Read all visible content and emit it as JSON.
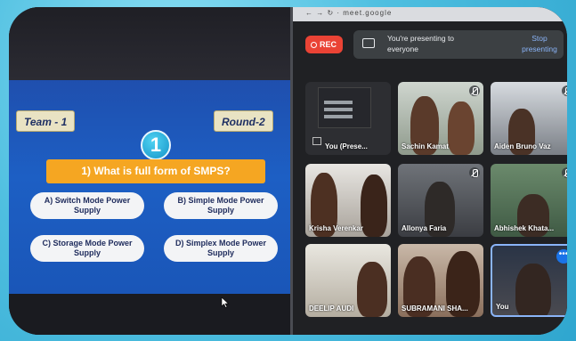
{
  "slide": {
    "team": "Team - 1",
    "round": "Round-2",
    "question_number": "1",
    "question": "1) What is full form of SMPS?",
    "options": [
      {
        "line1": "A) Switch Mode Power",
        "line2": "Supply"
      },
      {
        "line1": "B) Simple Mode Power",
        "line2": "Supply"
      },
      {
        "line1": "C) Storage Mode Power",
        "line2": "Supply"
      },
      {
        "line1": "D) Simplex Mode Power",
        "line2": "Supply"
      }
    ]
  },
  "meet": {
    "rec_label": "REC",
    "presenting_line1": "You're presenting to",
    "presenting_line2": "everyone",
    "stop_line1": "Stop",
    "stop_line2": "presenting",
    "tiles": [
      {
        "name": "You (Prese..."
      },
      {
        "name": "Sachin Kamat"
      },
      {
        "name": "Aiden Bruno Vaz"
      },
      {
        "name": "Krisha Verenkar"
      },
      {
        "name": "Allonya Faria"
      },
      {
        "name": "Abhishek Khata..."
      },
      {
        "name": "DEELIP AUDI"
      },
      {
        "name": "SUBRAMANI SHA..."
      },
      {
        "name": "You"
      }
    ]
  },
  "colors": {
    "slide_bg": "#1d5fc4",
    "question_bar": "#f5a622",
    "rec_red": "#ea4335",
    "accent_blue": "#8ab4f8"
  }
}
